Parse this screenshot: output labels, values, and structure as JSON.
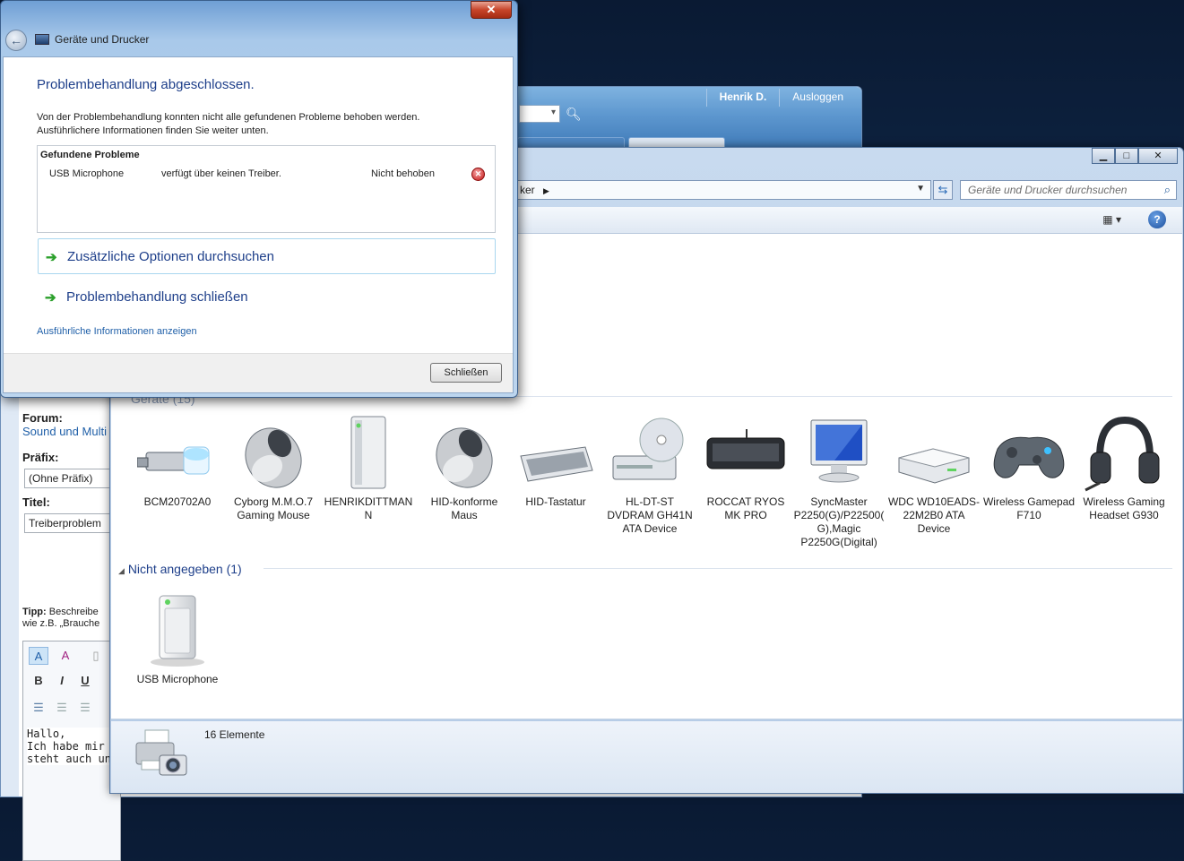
{
  "browser": {
    "user_name": "Henrik D.",
    "logout": "Ausloggen",
    "forum_label": "Forum:",
    "forum_value": "Sound und Multi",
    "prefix_label": "Präfix:",
    "prefix_value": "(Ohne Präfix)",
    "title_label": "Titel:",
    "title_value": "Treiberproblem",
    "tip_bold": "Tipp:",
    "tip_text": " Beschreibe",
    "tip_line2": "wie z.B. „Brauche",
    "editor_text": [
      "Hallo,",
      "Ich habe mir d",
      "steht auch un"
    ]
  },
  "explorer": {
    "address_tail": "ker",
    "search_placeholder": "Geräte und Drucker durchsuchen",
    "groups": {
      "devices_partial": "Geräte (15)",
      "unspecified": "Nicht angegeben (1)"
    },
    "devices": [
      {
        "label": "BCM20702A0",
        "icon": "usb-bluetooth-icon"
      },
      {
        "label": "Cyborg M.M.O.7 Gaming Mouse",
        "icon": "mouse-icon"
      },
      {
        "label": "HENRIKDITTMANN",
        "icon": "computer-tower-icon"
      },
      {
        "label": "HID-konforme Maus",
        "icon": "mouse-icon"
      },
      {
        "label": "HID-Tastatur",
        "icon": "keyboard-icon"
      },
      {
        "label": "HL-DT-ST DVDRAM GH41N ATA Device",
        "icon": "optical-drive-icon"
      },
      {
        "label": "ROCCAT RYOS MK PRO",
        "icon": "gaming-keyboard-icon"
      },
      {
        "label": "SyncMaster P2250(G)/P22500(G),Magic P2250G(Digital)",
        "icon": "monitor-icon"
      },
      {
        "label": "WDC WD10EADS-22M2B0 ATA Device",
        "icon": "hard-drive-icon"
      },
      {
        "label": "Wireless Gamepad F710",
        "icon": "gamepad-icon"
      },
      {
        "label": "Wireless Gaming Headset G930",
        "icon": "headset-icon"
      }
    ],
    "unspecified_devices": [
      {
        "label": "USB Microphone",
        "icon": "generic-device-icon"
      }
    ],
    "status_count": "16 Elemente"
  },
  "dialog": {
    "window_title": "Geräte und Drucker",
    "heading": "Problembehandlung abgeschlossen.",
    "message_line1": "Von der Problembehandlung konnten nicht alle gefundenen Probleme behoben werden.",
    "message_line2": "Ausführlichere Informationen finden Sie weiter unten.",
    "problems_header": "Gefundene Probleme",
    "problem": {
      "device": "USB Microphone",
      "description": "verfügt über keinen Treiber.",
      "status": "Nicht behoben"
    },
    "option_more": "Zusätzliche Optionen durchsuchen",
    "option_close": "Problembehandlung schließen",
    "details_link": "Ausführliche Informationen anzeigen",
    "close_button": "Schließen"
  },
  "colors": {
    "link_blue": "#1f5fa8",
    "heading_blue": "#1e3f8a",
    "error_red": "#c21616",
    "arrow_green": "#2ca02c"
  }
}
